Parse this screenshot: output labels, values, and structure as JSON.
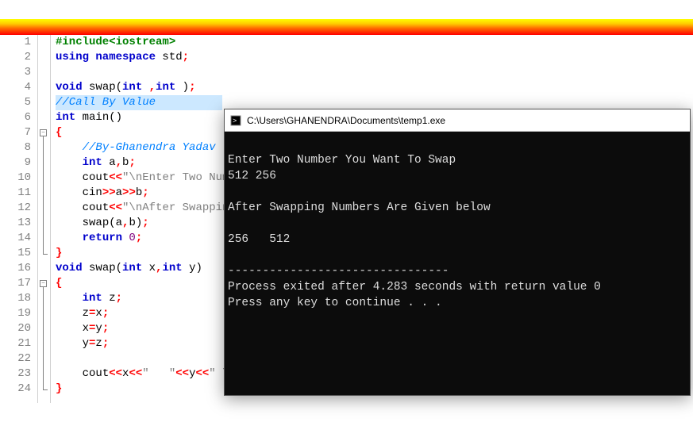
{
  "gradient_bar": "decorative",
  "editor": {
    "lines": [
      {
        "n": "1",
        "tokens": [
          {
            "c": "pp",
            "t": "#include<iostream>"
          }
        ]
      },
      {
        "n": "2",
        "tokens": [
          {
            "c": "kw",
            "t": "using namespace "
          },
          {
            "c": "id",
            "t": "std"
          },
          {
            "c": "op",
            "t": ";"
          }
        ]
      },
      {
        "n": "3",
        "tokens": []
      },
      {
        "n": "4",
        "tokens": [
          {
            "c": "kw",
            "t": "void "
          },
          {
            "c": "fn",
            "t": "swap"
          },
          {
            "c": "paren",
            "t": "("
          },
          {
            "c": "kw",
            "t": "int "
          },
          {
            "c": "op",
            "t": ","
          },
          {
            "c": "kw",
            "t": "int "
          },
          {
            "c": "paren",
            "t": ")"
          },
          {
            "c": "op",
            "t": ";"
          }
        ]
      },
      {
        "n": "5",
        "hl": true,
        "tokens": [
          {
            "c": "cm",
            "t": "//Call By Value          "
          }
        ]
      },
      {
        "n": "6",
        "tokens": [
          {
            "c": "kw",
            "t": "int "
          },
          {
            "c": "fn",
            "t": "main"
          },
          {
            "c": "paren",
            "t": "()"
          }
        ]
      },
      {
        "n": "7",
        "fold": "open",
        "tokens": [
          {
            "c": "brace",
            "t": "{"
          }
        ]
      },
      {
        "n": "8",
        "tokens": [
          {
            "c": "",
            "t": "    "
          },
          {
            "c": "cm",
            "t": "//By-Ghanendra Yadav"
          }
        ]
      },
      {
        "n": "9",
        "tokens": [
          {
            "c": "",
            "t": "    "
          },
          {
            "c": "kw",
            "t": "int "
          },
          {
            "c": "id",
            "t": "a"
          },
          {
            "c": "op",
            "t": ","
          },
          {
            "c": "id",
            "t": "b"
          },
          {
            "c": "op",
            "t": ";"
          }
        ]
      },
      {
        "n": "10",
        "tokens": [
          {
            "c": "",
            "t": "    "
          },
          {
            "c": "id",
            "t": "cout"
          },
          {
            "c": "op",
            "t": "<<"
          },
          {
            "c": "str",
            "t": "\"\\nEnter Two Number You Want To Swap \\n\""
          },
          {
            "c": "op",
            "t": ";"
          }
        ]
      },
      {
        "n": "11",
        "tokens": [
          {
            "c": "",
            "t": "    "
          },
          {
            "c": "id",
            "t": "cin"
          },
          {
            "c": "op",
            "t": ">>"
          },
          {
            "c": "id",
            "t": "a"
          },
          {
            "c": "op",
            "t": ">>"
          },
          {
            "c": "id",
            "t": "b"
          },
          {
            "c": "op",
            "t": ";"
          }
        ]
      },
      {
        "n": "12",
        "tokens": [
          {
            "c": "",
            "t": "    "
          },
          {
            "c": "id",
            "t": "cout"
          },
          {
            "c": "op",
            "t": "<<"
          },
          {
            "c": "str",
            "t": "\"\\nAfter Swapping Numbers Are Given below\\n\\n\""
          },
          {
            "c": "op",
            "t": ";"
          }
        ]
      },
      {
        "n": "13",
        "tokens": [
          {
            "c": "",
            "t": "    "
          },
          {
            "c": "id",
            "t": "swap"
          },
          {
            "c": "paren",
            "t": "("
          },
          {
            "c": "id",
            "t": "a"
          },
          {
            "c": "op",
            "t": ","
          },
          {
            "c": "id",
            "t": "b"
          },
          {
            "c": "paren",
            "t": ")"
          },
          {
            "c": "op",
            "t": ";"
          }
        ]
      },
      {
        "n": "14",
        "tokens": [
          {
            "c": "",
            "t": "    "
          },
          {
            "c": "kw",
            "t": "return "
          },
          {
            "c": "num",
            "t": "0"
          },
          {
            "c": "op",
            "t": ";"
          }
        ]
      },
      {
        "n": "15",
        "foldend": true,
        "tokens": [
          {
            "c": "brace",
            "t": "}"
          }
        ]
      },
      {
        "n": "16",
        "tokens": [
          {
            "c": "kw",
            "t": "void "
          },
          {
            "c": "fn",
            "t": "swap"
          },
          {
            "c": "paren",
            "t": "("
          },
          {
            "c": "kw",
            "t": "int "
          },
          {
            "c": "id",
            "t": "x"
          },
          {
            "c": "op",
            "t": ","
          },
          {
            "c": "kw",
            "t": "int "
          },
          {
            "c": "id",
            "t": "y"
          },
          {
            "c": "paren",
            "t": ")"
          }
        ]
      },
      {
        "n": "17",
        "fold": "open",
        "tokens": [
          {
            "c": "brace",
            "t": "{"
          }
        ]
      },
      {
        "n": "18",
        "tokens": [
          {
            "c": "",
            "t": "    "
          },
          {
            "c": "kw",
            "t": "int "
          },
          {
            "c": "id",
            "t": "z"
          },
          {
            "c": "op",
            "t": ";"
          }
        ]
      },
      {
        "n": "19",
        "tokens": [
          {
            "c": "",
            "t": "    "
          },
          {
            "c": "id",
            "t": "z"
          },
          {
            "c": "op",
            "t": "="
          },
          {
            "c": "id",
            "t": "x"
          },
          {
            "c": "op",
            "t": ";"
          }
        ]
      },
      {
        "n": "20",
        "tokens": [
          {
            "c": "",
            "t": "    "
          },
          {
            "c": "id",
            "t": "x"
          },
          {
            "c": "op",
            "t": "="
          },
          {
            "c": "id",
            "t": "y"
          },
          {
            "c": "op",
            "t": ";"
          }
        ]
      },
      {
        "n": "21",
        "tokens": [
          {
            "c": "",
            "t": "    "
          },
          {
            "c": "id",
            "t": "y"
          },
          {
            "c": "op",
            "t": "="
          },
          {
            "c": "id",
            "t": "z"
          },
          {
            "c": "op",
            "t": ";"
          }
        ]
      },
      {
        "n": "22",
        "tokens": []
      },
      {
        "n": "23",
        "tokens": [
          {
            "c": "",
            "t": "    "
          },
          {
            "c": "id",
            "t": "cout"
          },
          {
            "c": "op",
            "t": "<<"
          },
          {
            "c": "id",
            "t": "x"
          },
          {
            "c": "op",
            "t": "<<"
          },
          {
            "c": "str",
            "t": "\"   \""
          },
          {
            "c": "op",
            "t": "<<"
          },
          {
            "c": "id",
            "t": "y"
          },
          {
            "c": "op",
            "t": "<<"
          },
          {
            "c": "str",
            "t": "\" \\n\""
          },
          {
            "c": "op",
            "t": ";"
          }
        ]
      },
      {
        "n": "24",
        "foldend": true,
        "tokens": [
          {
            "c": "brace",
            "t": "}"
          }
        ]
      }
    ]
  },
  "console": {
    "title": "C:\\Users\\GHANENDRA\\Documents\\temp1.exe",
    "lines": [
      "",
      "Enter Two Number You Want To Swap",
      "512 256",
      "",
      "After Swapping Numbers Are Given below",
      "",
      "256   512",
      "",
      "--------------------------------",
      "Process exited after 4.283 seconds with return value 0",
      "Press any key to continue . . ."
    ]
  }
}
